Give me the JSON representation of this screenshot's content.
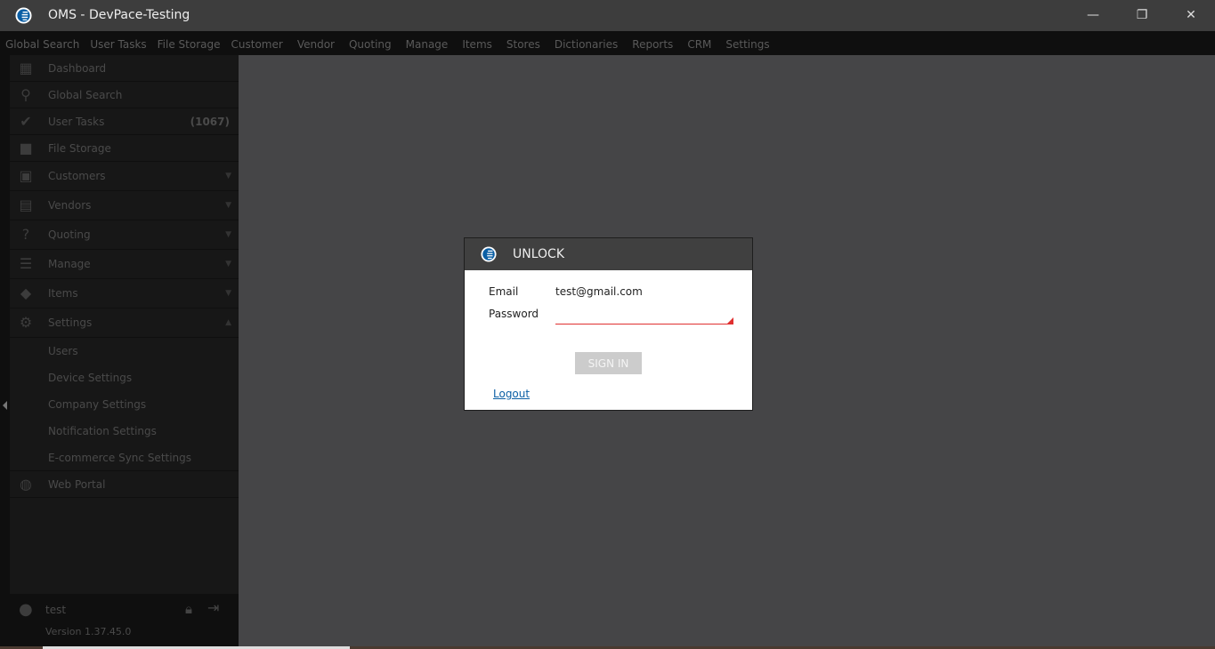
{
  "window": {
    "title": "OMS - DevPace-Testing",
    "minimize": "—",
    "maximize": "❐",
    "close": "✕"
  },
  "menu": [
    "Global Search",
    "User Tasks",
    "File Storage",
    "Customer",
    "Vendor",
    "Quoting",
    "Manage",
    "Items",
    "Stores",
    "Dictionaries",
    "Reports",
    "CRM",
    "Settings"
  ],
  "sidebar": {
    "dashboard": "Dashboard",
    "global_search": "Global Search",
    "user_tasks": "User Tasks",
    "user_tasks_count": "(1067)",
    "file_storage": "File Storage",
    "customers": "Customers",
    "vendors": "Vendors",
    "quoting": "Quoting",
    "manage": "Manage",
    "items": "Items",
    "settings": "Settings",
    "settings_sub": [
      "Users",
      "Device Settings",
      "Company Settings",
      "Notification Settings",
      "E-commerce Sync Settings"
    ],
    "web_portal": "Web Portal"
  },
  "user": {
    "name": "test",
    "version": "Version 1.37.45.0"
  },
  "dialog": {
    "title": "UNLOCK",
    "email_label": "Email",
    "email_value": "test@gmail.com",
    "password_label": "Password",
    "password_value": "",
    "sign_in": "SIGN IN",
    "logout": "Logout"
  },
  "colors": {
    "accent": "#0b5fa5",
    "error": "#e03030"
  }
}
